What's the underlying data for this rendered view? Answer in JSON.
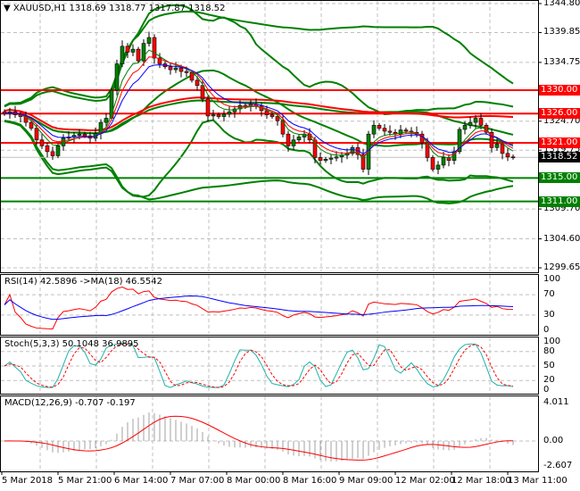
{
  "chart_data": {
    "type": "candlestick",
    "symbol_header": {
      "symbol": "XAUUSD,H1",
      "open": "1318.69",
      "high": "1318.77",
      "low": "1317.87",
      "close": "1318.52"
    },
    "price_axis_ticks": [
      "1344.80",
      "1339.85",
      "1334.75",
      "1324.70",
      "1319.75",
      "1309.70",
      "1304.60",
      "1299.65"
    ],
    "price_axis_values": [
      1344.8,
      1339.85,
      1334.75,
      1324.7,
      1319.75,
      1309.7,
      1304.6,
      1299.65
    ],
    "ylim": [
      1299.65,
      1344.8
    ],
    "levels": [
      {
        "label": "1330.00",
        "value": 1330.0,
        "color": "#ff0000"
      },
      {
        "label": "1326.00",
        "value": 1326.0,
        "color": "#ff0000"
      },
      {
        "label": "1321.00",
        "value": 1321.0,
        "color": "#ff0000"
      },
      {
        "label": "1315.00",
        "value": 1315.0,
        "color": "#008000"
      },
      {
        "label": "1311.00",
        "value": 1311.0,
        "color": "#008000"
      }
    ],
    "current_price": {
      "label": "1318.52",
      "value": 1318.52
    },
    "closes": [
      1326,
      1326.3,
      1325.8,
      1325.5,
      1324.5,
      1323.5,
      1321.5,
      1320.5,
      1319.5,
      1318.8,
      1320.5,
      1321.8,
      1322,
      1322.3,
      1322.5,
      1322.2,
      1321.8,
      1322.6,
      1324.5,
      1325.2,
      1330,
      1334.5,
      1337.5,
      1336.5,
      1337,
      1335,
      1338,
      1339,
      1335.5,
      1334.5,
      1334,
      1333.5,
      1333.8,
      1333.2,
      1333,
      1331.7,
      1330.8,
      1328.5,
      1325.6,
      1325.8,
      1325.5,
      1325.9,
      1326.3,
      1326.8,
      1327.4,
      1327.2,
      1327.6,
      1327.3,
      1326.5,
      1325.8,
      1325.5,
      1324.8,
      1322.5,
      1320.5,
      1321.5,
      1322,
      1322.5,
      1321.5,
      1318.5,
      1318,
      1318.2,
      1318.4,
      1318.6,
      1318.9,
      1319.2,
      1320.2,
      1319,
      1316.5,
      1322.5,
      1324,
      1323.5,
      1323,
      1322.8,
      1322.5,
      1323.2,
      1323,
      1322.8,
      1322.5,
      1321,
      1318.5,
      1316.5,
      1317.2,
      1318.5,
      1318,
      1319.5,
      1323.3,
      1324,
      1324.5,
      1325.2,
      1324,
      1322.8,
      1320.2,
      1320.8,
      1319.2,
      1318.6,
      1318.52
    ],
    "time_labels": [
      "5 Mar 2018",
      "5 Mar 21:00",
      "6 Mar 14:00",
      "7 Mar 07:00",
      "8 Mar 00:00",
      "8 Mar 16:00",
      "9 Mar 09:00",
      "12 Mar 02:00",
      "12 Mar 18:00",
      "13 Mar 11:00"
    ],
    "rsi": {
      "label": "RSI(14) 42.5896  ->MA(18) 46.5542",
      "ticks": [
        "100",
        "70",
        "30",
        "0"
      ],
      "tick_values": [
        100,
        70,
        30,
        0
      ]
    },
    "stoch": {
      "label": "Stoch(5,3,3) 50.1048 36.9895",
      "ticks": [
        "100",
        "80",
        "50",
        "20",
        "0"
      ],
      "tick_values": [
        100,
        80,
        50,
        20,
        0
      ]
    },
    "macd": {
      "label": "MACD(12,26,9) -0.707 -0.197",
      "ticks": [
        "4.011",
        "0.00",
        "-2.607"
      ],
      "tick_values": [
        4.011,
        0,
        -2.607
      ]
    },
    "colors": {
      "bull": "#008000",
      "bear": "#ff0000",
      "band": "#008000",
      "ma_fast": "#ff0000",
      "ma_slow": "#0000ff",
      "grid": "#c0c0c0",
      "stoch_main": "#20b2aa"
    }
  }
}
